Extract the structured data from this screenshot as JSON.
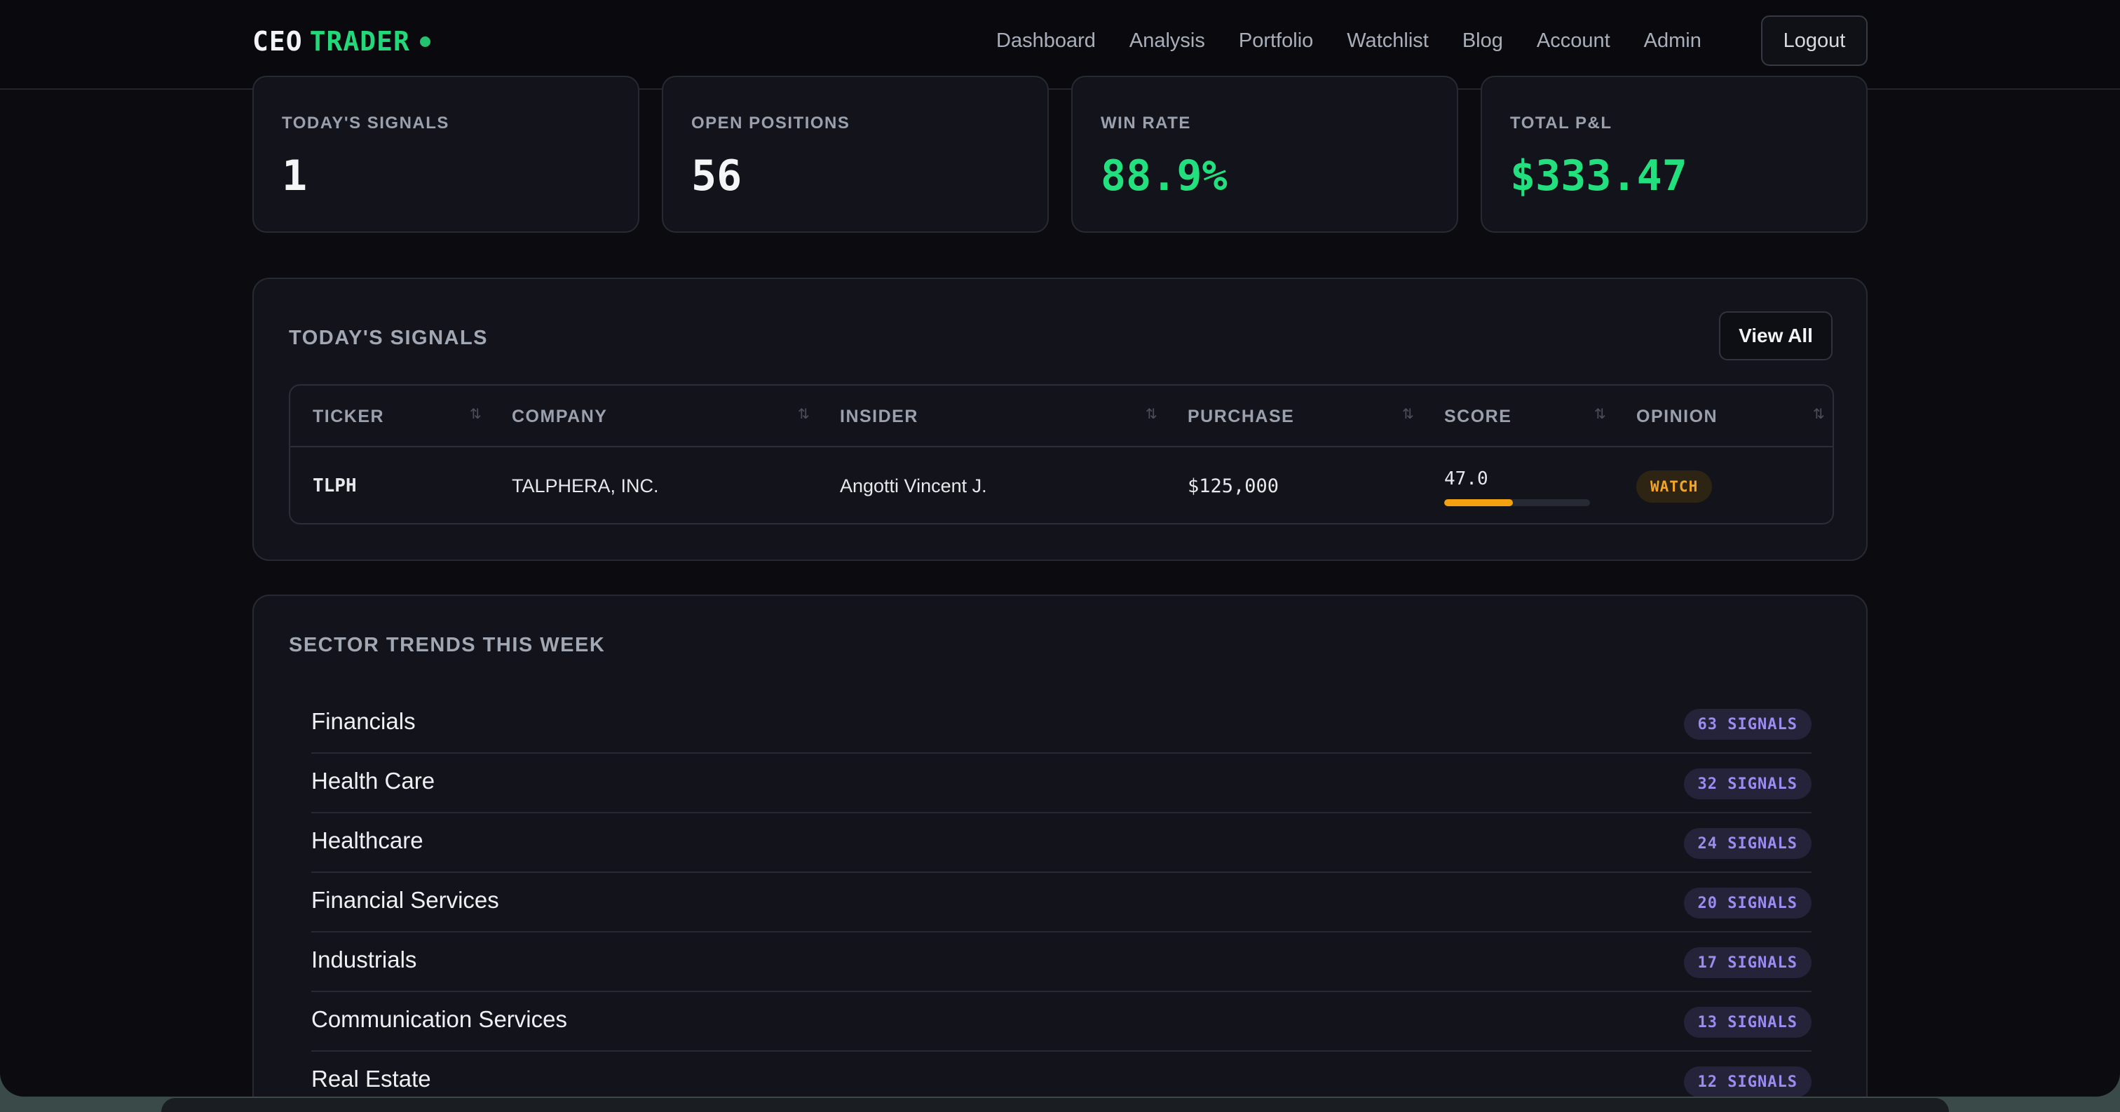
{
  "brand": {
    "part1": "CEO",
    "part2": "TRADER"
  },
  "nav": {
    "links": [
      "Dashboard",
      "Analysis",
      "Portfolio",
      "Watchlist",
      "Blog",
      "Account",
      "Admin"
    ],
    "logout": "Logout"
  },
  "stats": [
    {
      "label": "TODAY'S SIGNALS",
      "value": "1"
    },
    {
      "label": "OPEN POSITIONS",
      "value": "56"
    },
    {
      "label": "WIN RATE",
      "value": "88.9%"
    },
    {
      "label": "TOTAL P&L",
      "value": "$333.47"
    }
  ],
  "signals": {
    "title": "TODAY'S SIGNALS",
    "view_all": "View All",
    "columns": [
      "TICKER",
      "COMPANY",
      "INSIDER",
      "PURCHASE",
      "SCORE",
      "OPINION"
    ],
    "rows": [
      {
        "ticker": "TLPH",
        "company": "TALPHERA, INC.",
        "insider": "Angotti Vincent J.",
        "purchase": "$125,000",
        "score": "47.0",
        "score_fraction": 0.47,
        "opinion": "WATCH"
      }
    ]
  },
  "sectors": {
    "title": "SECTOR TRENDS THIS WEEK",
    "items": [
      {
        "name": "Financials",
        "count": "63 SIGNALS"
      },
      {
        "name": "Health Care",
        "count": "32 SIGNALS"
      },
      {
        "name": "Healthcare",
        "count": "24 SIGNALS"
      },
      {
        "name": "Financial Services",
        "count": "20 SIGNALS"
      },
      {
        "name": "Industrials",
        "count": "17 SIGNALS"
      },
      {
        "name": "Communication Services",
        "count": "13 SIGNALS"
      },
      {
        "name": "Real Estate",
        "count": "12 SIGNALS"
      }
    ]
  },
  "colors": {
    "accent_green": "#22e07e",
    "score_orange": "#f5a011",
    "badge_purple": "#9d8cf0"
  }
}
